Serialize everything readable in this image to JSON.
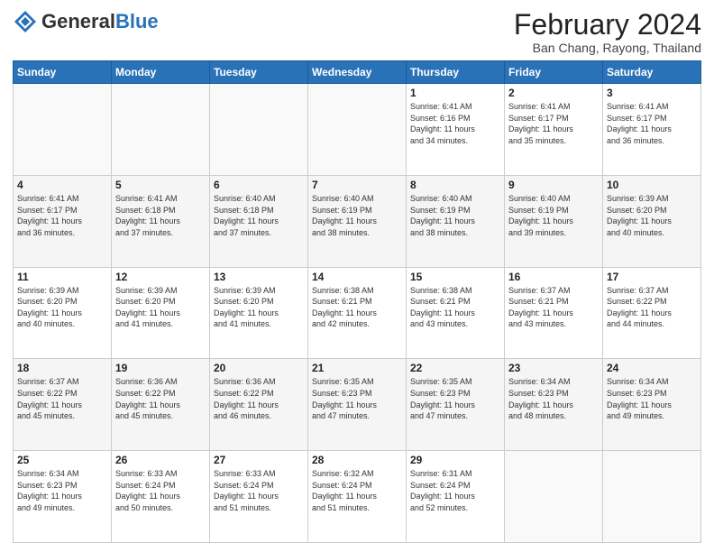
{
  "header": {
    "logo_general": "General",
    "logo_blue": "Blue",
    "month_year": "February 2024",
    "location": "Ban Chang, Rayong, Thailand"
  },
  "days_of_week": [
    "Sunday",
    "Monday",
    "Tuesday",
    "Wednesday",
    "Thursday",
    "Friday",
    "Saturday"
  ],
  "weeks": [
    [
      {
        "num": "",
        "info": ""
      },
      {
        "num": "",
        "info": ""
      },
      {
        "num": "",
        "info": ""
      },
      {
        "num": "",
        "info": ""
      },
      {
        "num": "1",
        "info": "Sunrise: 6:41 AM\nSunset: 6:16 PM\nDaylight: 11 hours\nand 34 minutes."
      },
      {
        "num": "2",
        "info": "Sunrise: 6:41 AM\nSunset: 6:17 PM\nDaylight: 11 hours\nand 35 minutes."
      },
      {
        "num": "3",
        "info": "Sunrise: 6:41 AM\nSunset: 6:17 PM\nDaylight: 11 hours\nand 36 minutes."
      }
    ],
    [
      {
        "num": "4",
        "info": "Sunrise: 6:41 AM\nSunset: 6:17 PM\nDaylight: 11 hours\nand 36 minutes."
      },
      {
        "num": "5",
        "info": "Sunrise: 6:41 AM\nSunset: 6:18 PM\nDaylight: 11 hours\nand 37 minutes."
      },
      {
        "num": "6",
        "info": "Sunrise: 6:40 AM\nSunset: 6:18 PM\nDaylight: 11 hours\nand 37 minutes."
      },
      {
        "num": "7",
        "info": "Sunrise: 6:40 AM\nSunset: 6:19 PM\nDaylight: 11 hours\nand 38 minutes."
      },
      {
        "num": "8",
        "info": "Sunrise: 6:40 AM\nSunset: 6:19 PM\nDaylight: 11 hours\nand 38 minutes."
      },
      {
        "num": "9",
        "info": "Sunrise: 6:40 AM\nSunset: 6:19 PM\nDaylight: 11 hours\nand 39 minutes."
      },
      {
        "num": "10",
        "info": "Sunrise: 6:39 AM\nSunset: 6:20 PM\nDaylight: 11 hours\nand 40 minutes."
      }
    ],
    [
      {
        "num": "11",
        "info": "Sunrise: 6:39 AM\nSunset: 6:20 PM\nDaylight: 11 hours\nand 40 minutes."
      },
      {
        "num": "12",
        "info": "Sunrise: 6:39 AM\nSunset: 6:20 PM\nDaylight: 11 hours\nand 41 minutes."
      },
      {
        "num": "13",
        "info": "Sunrise: 6:39 AM\nSunset: 6:20 PM\nDaylight: 11 hours\nand 41 minutes."
      },
      {
        "num": "14",
        "info": "Sunrise: 6:38 AM\nSunset: 6:21 PM\nDaylight: 11 hours\nand 42 minutes."
      },
      {
        "num": "15",
        "info": "Sunrise: 6:38 AM\nSunset: 6:21 PM\nDaylight: 11 hours\nand 43 minutes."
      },
      {
        "num": "16",
        "info": "Sunrise: 6:37 AM\nSunset: 6:21 PM\nDaylight: 11 hours\nand 43 minutes."
      },
      {
        "num": "17",
        "info": "Sunrise: 6:37 AM\nSunset: 6:22 PM\nDaylight: 11 hours\nand 44 minutes."
      }
    ],
    [
      {
        "num": "18",
        "info": "Sunrise: 6:37 AM\nSunset: 6:22 PM\nDaylight: 11 hours\nand 45 minutes."
      },
      {
        "num": "19",
        "info": "Sunrise: 6:36 AM\nSunset: 6:22 PM\nDaylight: 11 hours\nand 45 minutes."
      },
      {
        "num": "20",
        "info": "Sunrise: 6:36 AM\nSunset: 6:22 PM\nDaylight: 11 hours\nand 46 minutes."
      },
      {
        "num": "21",
        "info": "Sunrise: 6:35 AM\nSunset: 6:23 PM\nDaylight: 11 hours\nand 47 minutes."
      },
      {
        "num": "22",
        "info": "Sunrise: 6:35 AM\nSunset: 6:23 PM\nDaylight: 11 hours\nand 47 minutes."
      },
      {
        "num": "23",
        "info": "Sunrise: 6:34 AM\nSunset: 6:23 PM\nDaylight: 11 hours\nand 48 minutes."
      },
      {
        "num": "24",
        "info": "Sunrise: 6:34 AM\nSunset: 6:23 PM\nDaylight: 11 hours\nand 49 minutes."
      }
    ],
    [
      {
        "num": "25",
        "info": "Sunrise: 6:34 AM\nSunset: 6:23 PM\nDaylight: 11 hours\nand 49 minutes."
      },
      {
        "num": "26",
        "info": "Sunrise: 6:33 AM\nSunset: 6:24 PM\nDaylight: 11 hours\nand 50 minutes."
      },
      {
        "num": "27",
        "info": "Sunrise: 6:33 AM\nSunset: 6:24 PM\nDaylight: 11 hours\nand 51 minutes."
      },
      {
        "num": "28",
        "info": "Sunrise: 6:32 AM\nSunset: 6:24 PM\nDaylight: 11 hours\nand 51 minutes."
      },
      {
        "num": "29",
        "info": "Sunrise: 6:31 AM\nSunset: 6:24 PM\nDaylight: 11 hours\nand 52 minutes."
      },
      {
        "num": "",
        "info": ""
      },
      {
        "num": "",
        "info": ""
      }
    ]
  ]
}
